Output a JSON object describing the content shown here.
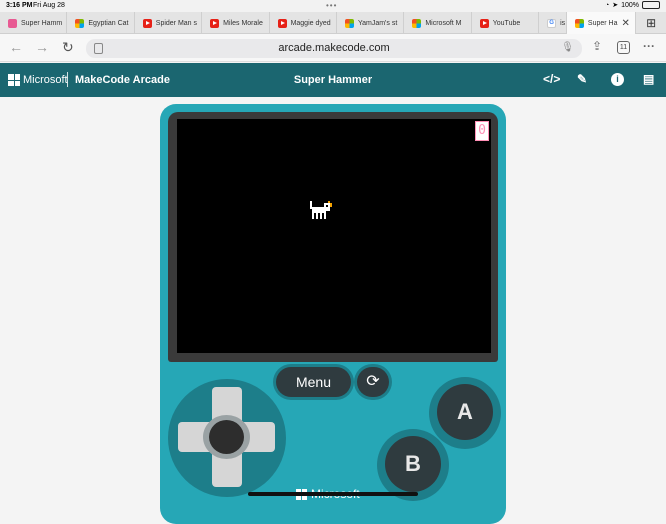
{
  "status_bar": {
    "time": "3:16 PM",
    "date": "Fri Aug 28",
    "battery": "100%",
    "battery_level": 1.0
  },
  "tabs": [
    {
      "label": "Super Hamm",
      "icon": "makecode-favicon"
    },
    {
      "label": "Egyptian Cat",
      "icon": "microsoft-favicon"
    },
    {
      "label": "Spider Man s",
      "icon": "youtube-favicon"
    },
    {
      "label": "Miles Morale",
      "icon": "youtube-favicon"
    },
    {
      "label": "Maggie dyed",
      "icon": "youtube-favicon"
    },
    {
      "label": "YamJam's st",
      "icon": "microsoft-favicon"
    },
    {
      "label": "Microsoft M",
      "icon": "microsoft-favicon"
    },
    {
      "label": "YouTube",
      "icon": "youtube-favicon"
    },
    {
      "label": "is",
      "icon": "google-favicon"
    },
    {
      "label": "Super Ha",
      "icon": "microsoft-favicon",
      "active": true
    }
  ],
  "address_bar": {
    "url": "arcade.makecode.com",
    "tab_count": "11"
  },
  "makecode": {
    "brand": "Microsoft",
    "app_name": "MakeCode Arcade",
    "project_title": "Super Hammer",
    "brand_color": "#1b6670"
  },
  "game": {
    "score": "0",
    "menu_label": "Menu",
    "a_label": "A",
    "b_label": "B",
    "footer_brand": "Microsoft",
    "console_color": "#26a7b6"
  }
}
